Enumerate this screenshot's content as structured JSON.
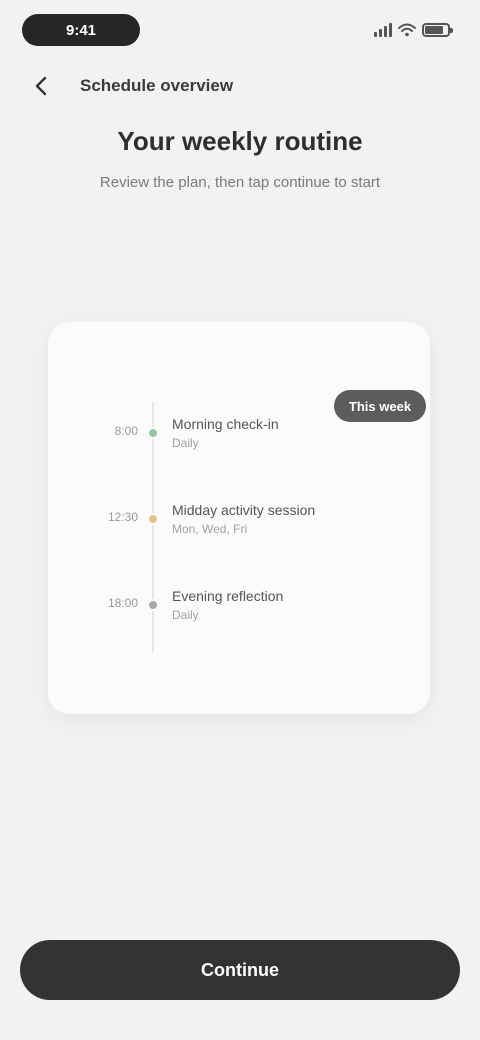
{
  "status_bar": {
    "time": "9:41",
    "signal_icon": "signal-icon",
    "wifi_icon": "wifi-icon",
    "battery_icon": "battery-icon"
  },
  "app_bar": {
    "back_icon": "back-arrow-icon",
    "title": "Schedule overview"
  },
  "intro": {
    "heading": "Your weekly routine",
    "subheading": "Review the plan, then tap continue to start"
  },
  "card": {
    "badge_label": "This week",
    "timeline": [
      {
        "time": "8:00",
        "title": "Morning check-in",
        "subtitle": "Daily",
        "dot_color": "#8fc7a4"
      },
      {
        "time": "12:30",
        "title": "Midday activity session",
        "subtitle": "Mon, Wed, Fri",
        "dot_color": "#e7c08c"
      },
      {
        "time": "18:00",
        "title": "Evening reflection",
        "subtitle": "Daily",
        "dot_color": "#a8a8a8"
      }
    ]
  },
  "footer": {
    "button_label": "Continue"
  }
}
